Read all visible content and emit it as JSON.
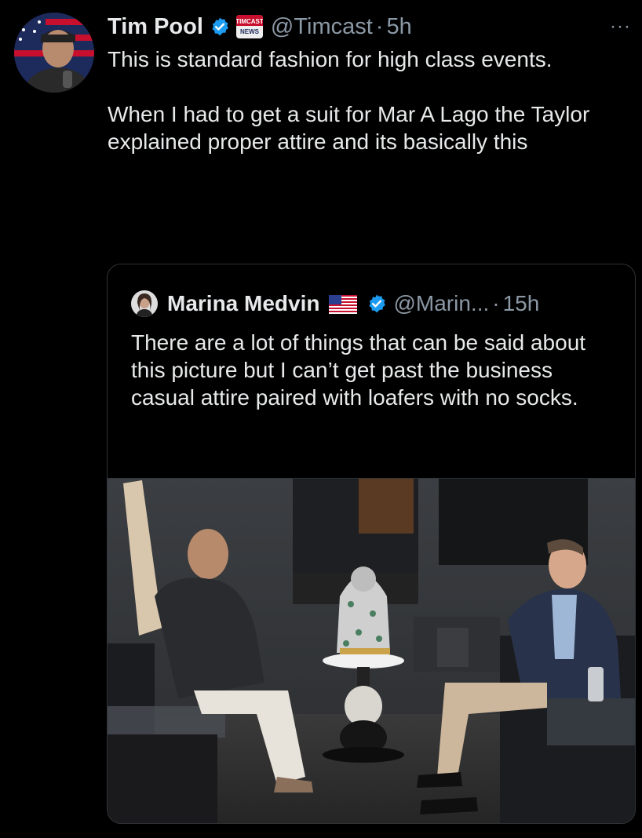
{
  "tweet": {
    "author_name": "Tim Pool",
    "handle": "@Timcast",
    "separator": "·",
    "time": "5h",
    "more_label": "···",
    "badge_text": "TIMCAST NEWS",
    "paragraphs": [
      "This is standard fashion for high class events.",
      "When I had to get a suit for Mar A Lago the Taylor explained proper attire and its basically this"
    ]
  },
  "quoted": {
    "author_name": "Marina Medvin",
    "handle": "@Marin...",
    "separator": "·",
    "time": "15h",
    "text": "There are a lot of things that can be said about this picture but I can’t get past the business casual attire paired with loafers with no socks."
  },
  "icons": {
    "verified": "verified-check-icon",
    "more": "more-options-icon",
    "flag": "us-flag-icon"
  },
  "colors": {
    "background": "#000000",
    "text": "#e7e9ea",
    "secondary": "#8b98a5",
    "verified": "#1d9bf0",
    "border": "#2f3336"
  }
}
